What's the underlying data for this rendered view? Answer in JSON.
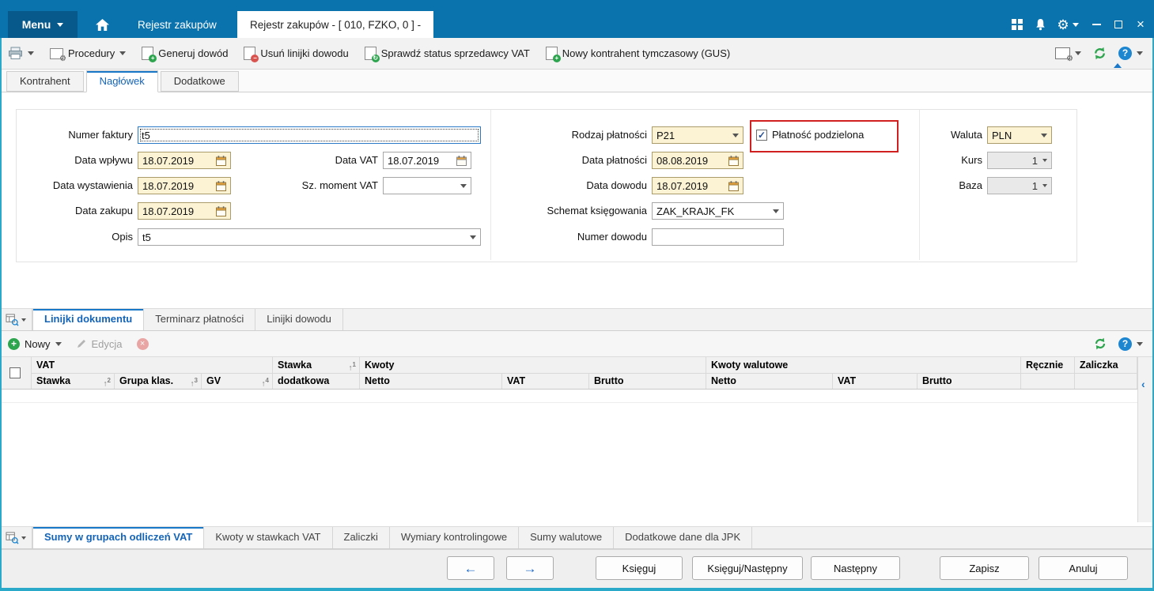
{
  "colors": {
    "titlebar": "#0a73ae",
    "accent_blue": "#1a78c8",
    "field_beige": "#fcf3d5",
    "annotation_red": "#d02020",
    "refresh_green": "#2da44e",
    "window_edge_teal": "#2aa9c9"
  },
  "titlebar": {
    "menu_label": "Menu",
    "nav_tab": "Rejestr zakupów",
    "active_tab": "Rejestr zakupów - [ 010, FZKO, 0 ] -"
  },
  "toolbar": {
    "procedury": "Procedury",
    "generuj_dowod": "Generuj dowód",
    "usun_linijki": "Usuń linijki dowodu",
    "sprawdz_status": "Sprawdź status sprzedawcy VAT",
    "nowy_kontrahent": "Nowy kontrahent tymczasowy (GUS)"
  },
  "header_tabs": {
    "kontrahent": "Kontrahent",
    "naglowek": "Nagłówek",
    "dodatkowe": "Dodatkowe"
  },
  "form": {
    "numer_faktury_label": "Numer faktury",
    "numer_faktury_value": "t5",
    "data_wplywu_label": "Data wpływu",
    "data_wplywu_value": "18.07.2019",
    "data_wystawienia_label": "Data wystawienia",
    "data_wystawienia_value": "18.07.2019",
    "data_zakupu_label": "Data zakupu",
    "data_zakupu_value": "18.07.2019",
    "opis_label": "Opis",
    "opis_value": "t5",
    "data_vat_label": "Data VAT",
    "data_vat_value": "18.07.2019",
    "sz_moment_vat_label": "Sz. moment VAT",
    "sz_moment_vat_value": "",
    "rodzaj_platnosci_label": "Rodzaj płatności",
    "rodzaj_platnosci_value": "P21",
    "platnosc_podzielona_label": "Płatność podzielona",
    "platnosc_podzielona_checked": true,
    "data_platnosci_label": "Data płatności",
    "data_platnosci_value": "08.08.2019",
    "data_dowodu_label": "Data dowodu",
    "data_dowodu_value": "18.07.2019",
    "schemat_label": "Schemat księgowania",
    "schemat_value": "ZAK_KRAJK_FK",
    "numer_dowodu_label": "Numer dowodu",
    "numer_dowodu_value": "",
    "waluta_label": "Waluta",
    "waluta_value": "PLN",
    "kurs_label": "Kurs",
    "kurs_value": "1",
    "baza_label": "Baza",
    "baza_value": "1"
  },
  "grid_tabs": {
    "linijki_dokumentu": "Linijki dokumentu",
    "terminarz": "Terminarz płatności",
    "linijki_dowodu": "Linijki dowodu"
  },
  "grid_toolbar": {
    "nowy": "Nowy",
    "edycja": "Edycja"
  },
  "grid": {
    "band_vat": "VAT",
    "band_kwoty": "Kwoty",
    "band_kwoty_walutowe": "Kwoty walutowe",
    "band_recznie": "Ręcznie",
    "band_zaliczka": "Zaliczka",
    "col_stawka": "Stawka",
    "col_grupa_klas": "Grupa klas.",
    "col_gv": "GV",
    "col_stawka2": "Stawka",
    "col_dodatkowa": "dodatkowa",
    "col_netto": "Netto",
    "col_vat": "VAT",
    "col_brutto": "Brutto",
    "sort1": "1",
    "sort2": "2",
    "sort3": "3",
    "sort4": "4",
    "rows": []
  },
  "bottom_tabs": {
    "sumy_vat": "Sumy w grupach odliczeń VAT",
    "kwoty_stawki": "Kwoty w stawkach VAT",
    "zaliczki": "Zaliczki",
    "wymiary": "Wymiary kontrolingowe",
    "sumy_walutowe": "Sumy walutowe",
    "jpk": "Dodatkowe dane dla JPK"
  },
  "footer": {
    "ksieguj": "Księguj",
    "ksieguj_nastepny": "Księguj/Następny",
    "nastepny": "Następny",
    "zapisz": "Zapisz",
    "anuluj": "Anuluj"
  }
}
